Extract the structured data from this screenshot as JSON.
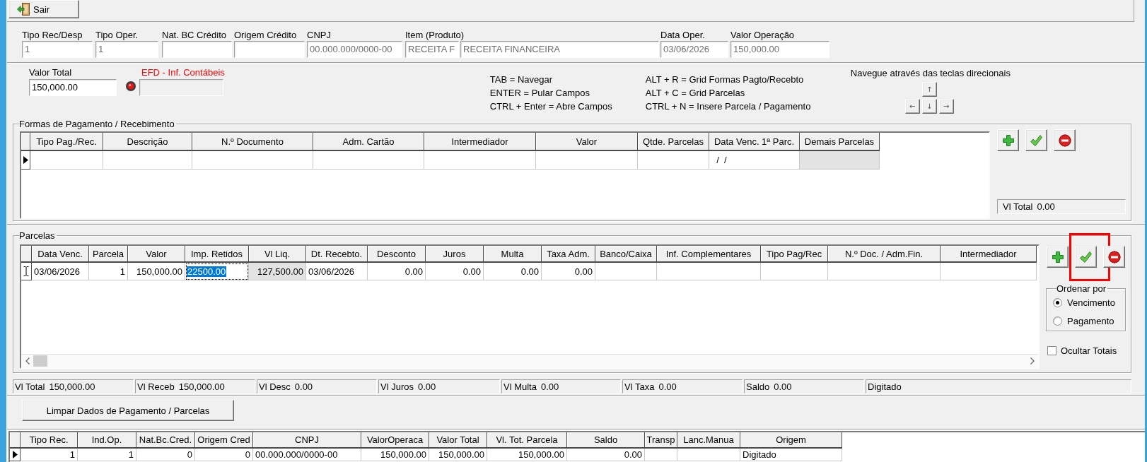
{
  "toolbar": {
    "exit_button": {
      "label": "Sair"
    }
  },
  "header_fields": [
    {
      "label": "Tipo Rec/Desp",
      "value": "1",
      "readonly": true
    },
    {
      "label": "Tipo Oper.",
      "value": "1",
      "readonly": true
    },
    {
      "label": "Nat. BC Crédito"
    },
    {
      "label": "Origem Crédito"
    },
    {
      "label": "CNPJ",
      "value": "00.000.000/0000-00",
      "readonly": true
    },
    {
      "label": "Item (Produto)",
      "value": "RECEITA F",
      "description": "RECEITA FINANCEIRA",
      "readonly": true
    },
    {
      "label": "Data Oper.",
      "value": "03/06/2026",
      "readonly": true
    },
    {
      "label": "Valor Operação",
      "value": "150,000.00",
      "readonly": true
    }
  ],
  "entry": {
    "total": {
      "label": "Valor Total",
      "value": "150,000.00",
      "readonly": false
    },
    "efd": {
      "label": "EFD - Inf. Contábeis",
      "disabled": true
    }
  },
  "shortcut_columns": [
    {
      "lines": [
        "TAB = Navegar",
        "ENTER = Pular Campos",
        "CTRL + Enter = Abre Campos"
      ]
    },
    {
      "lines": [
        "ALT + R = Grid Formas Pagto/Recebto",
        "ALT + C = Grid Parcelas",
        "CTRL + N = Insere Parcela / Pagamento"
      ]
    }
  ],
  "navigation": {
    "hint": "Navegue através das teclas direcionais",
    "keys": [
      {
        "kind": "up",
        "label": "↑"
      },
      {
        "kind": "left",
        "label": "←"
      },
      {
        "kind": "down",
        "label": "↓"
      },
      {
        "kind": "right",
        "label": "→"
      }
    ]
  },
  "payment_forms": {
    "title": "Formas de Pagamento / Recebimento",
    "columns": [
      {
        "label": "Tipo Pag./Rec.",
        "kind": "text"
      },
      {
        "label": "Descrição",
        "kind": "text"
      },
      {
        "label": "N.º Documento",
        "kind": "text"
      },
      {
        "label": "Adm. Cartão",
        "kind": "text"
      },
      {
        "label": "Intermediador",
        "kind": "text"
      },
      {
        "label": "Valor",
        "kind": "number"
      },
      {
        "label": "Qtde. Parcelas",
        "kind": "number"
      },
      {
        "label": "Data Venc. 1ª Parc.",
        "kind": "text"
      },
      {
        "label": "Demais Parcelas",
        "kind": "computed"
      }
    ],
    "rows": [
      {
        "editing": false,
        "cells": [
          null,
          null,
          null,
          null,
          null,
          null,
          null,
          "  /  /",
          null
        ]
      }
    ],
    "buttons": [
      {
        "kind": "add"
      },
      {
        "kind": "confirm"
      },
      {
        "kind": "remove"
      }
    ],
    "total": {
      "label": "Vl Total",
      "value": "0.00"
    }
  },
  "installments": {
    "title": "Parcelas",
    "columns": [
      {
        "label": "Data Venc.",
        "kind": "text"
      },
      {
        "label": "Parcela",
        "kind": "number"
      },
      {
        "label": "Valor",
        "kind": "number"
      },
      {
        "label": "Imp. Retidos",
        "kind": "number"
      },
      {
        "label": "Vl Liq.",
        "kind": "computed"
      },
      {
        "label": "Dt. Recebto.",
        "kind": "text"
      },
      {
        "label": "Desconto",
        "kind": "number"
      },
      {
        "label": "Juros",
        "kind": "number"
      },
      {
        "label": "Multa",
        "kind": "number"
      },
      {
        "label": "Taxa Adm.",
        "kind": "number"
      },
      {
        "label": "Banco/Caixa",
        "kind": "text"
      },
      {
        "label": "Inf. Complementares",
        "kind": "text"
      },
      {
        "label": "Tipo Pag/Rec",
        "kind": "text"
      },
      {
        "label": "N.º Doc. / Adm.Fin.",
        "kind": "text"
      },
      {
        "label": "Intermediador",
        "kind": "text"
      }
    ],
    "rows": [
      {
        "editing": true,
        "cells": [
          {
            "text": "03/06/2026",
            "selected": false
          },
          {
            "text": "1",
            "selected": false
          },
          {
            "text": "150,000.00",
            "selected": false
          },
          {
            "text": "22500.00",
            "selected": true
          },
          {
            "text": "127,500.00",
            "selected": false
          },
          {
            "text": "03/06/2026",
            "selected": false
          },
          {
            "text": "0.00",
            "selected": false
          },
          {
            "text": "0.00",
            "selected": false
          },
          {
            "text": "0.00",
            "selected": false
          },
          {
            "text": "0.00",
            "selected": false
          },
          {
            "selected": false
          },
          {
            "selected": false
          },
          {
            "selected": false
          },
          {
            "selected": false
          },
          {
            "selected": false
          }
        ]
      }
    ],
    "buttons": [
      {
        "kind": "add",
        "highlighted": false
      },
      {
        "kind": "confirm",
        "highlighted": true
      },
      {
        "kind": "remove",
        "highlighted": false
      }
    ],
    "order_by": {
      "title": "Ordenar por",
      "options": [
        {
          "label": "Vencimento",
          "selected": true
        },
        {
          "label": "Pagamento",
          "selected": false
        }
      ]
    },
    "hide_totals": {
      "label": "Ocultar Totais",
      "checked": false
    }
  },
  "totals": [
    {
      "label": "Vl Total",
      "value": "150,000.00"
    },
    {
      "label": "Vl Receb",
      "value": "150,000.00"
    },
    {
      "label": "Vl Desc",
      "value": "0.00"
    },
    {
      "label": "Vl Juros",
      "value": "0.00"
    },
    {
      "label": "Vl Multa",
      "value": "0.00"
    },
    {
      "label": "Vl Taxa",
      "value": "0.00"
    },
    {
      "label": "Saldo",
      "value": "0.00"
    },
    {
      "label": "Digitado"
    }
  ],
  "clear_button": {
    "label": "Limpar Dados de Pagamento / Parcelas"
  },
  "summary_grid": {
    "columns": [
      {
        "label": "Tipo Rec.",
        "kind": "number"
      },
      {
        "label": "Ind.Op.",
        "kind": "number"
      },
      {
        "label": "Nat.Bc.Cred.",
        "kind": "number"
      },
      {
        "label": "Origem Cred",
        "kind": "number"
      },
      {
        "label": "CNPJ",
        "kind": "text"
      },
      {
        "label": "ValorOperaca",
        "kind": "number"
      },
      {
        "label": "Valor Total",
        "kind": "number"
      },
      {
        "label": "Vl. Tot. Parcela",
        "kind": "number"
      },
      {
        "label": "Saldo",
        "kind": "number"
      },
      {
        "label": "Transp",
        "kind": "text"
      },
      {
        "label": "Lanc.Manua",
        "kind": "text"
      },
      {
        "label": "Origem",
        "kind": "text"
      }
    ],
    "rows": [
      {
        "editing": false,
        "cells": [
          "1",
          "1",
          "0",
          "0",
          "00.000.000/0000-00",
          "150,000.00",
          "150,000.00",
          "150,000.00",
          "0.00",
          null,
          null,
          "Digitado"
        ]
      }
    ]
  }
}
